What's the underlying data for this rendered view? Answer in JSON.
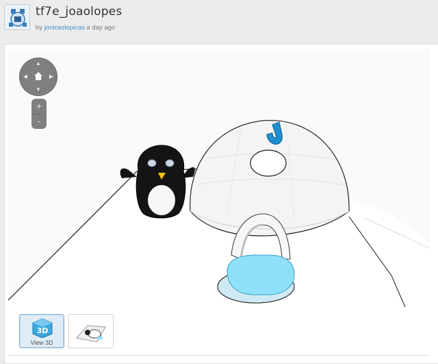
{
  "header": {
    "title": "tf7e_joaolopes",
    "by_prefix": "by",
    "author": "jonicaslopicas",
    "time": "a day ago"
  },
  "viewer": {
    "nav": {
      "up": "▲",
      "down": "▼",
      "left": "◀",
      "right": "▶"
    },
    "zoom": {
      "in": "+",
      "out": "-"
    },
    "thumbnails": [
      {
        "label": "View 3D",
        "badge": "3D",
        "active": true
      },
      {
        "label": "",
        "active": false
      }
    ],
    "model_letter": "J"
  },
  "colors": {
    "accent_blue": "#1e8fd0",
    "door_cyan": "#8fe0f8",
    "link": "#3f8fc9",
    "penguin_black": "#141414"
  }
}
